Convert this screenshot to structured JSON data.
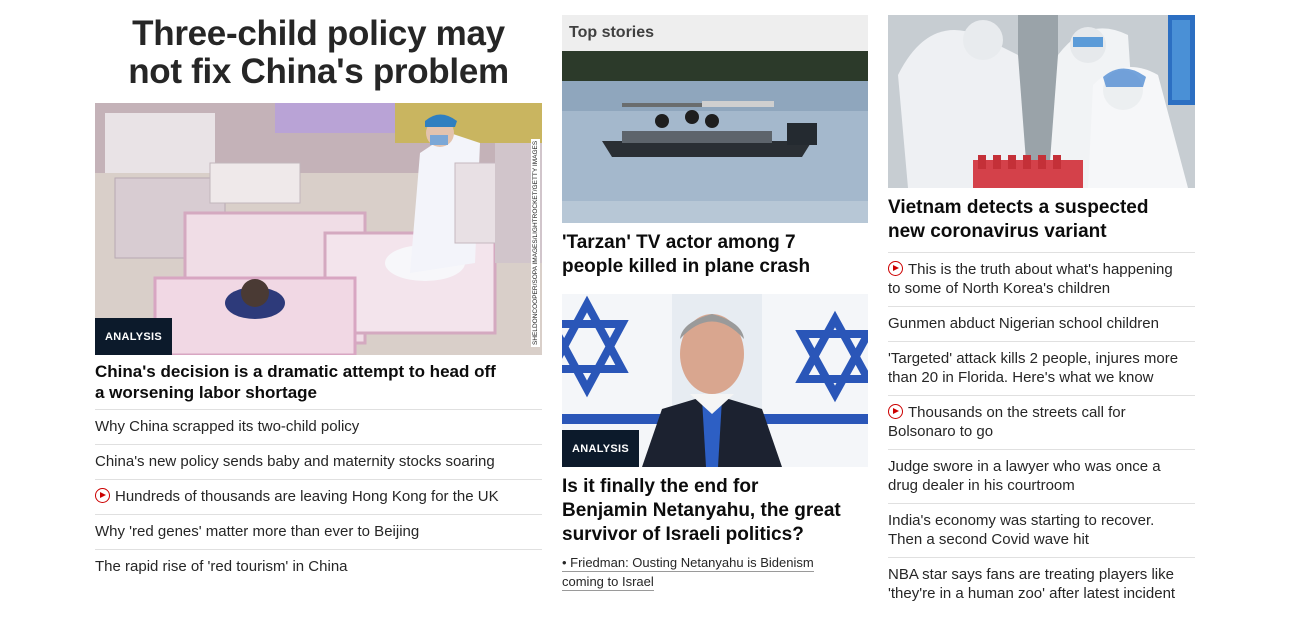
{
  "left": {
    "hero_title_line1": "Three-child policy may",
    "hero_title_line2": "not fix China's problem",
    "badge": "ANALYSIS",
    "credit": "SHELDONCOOPER/SOPA IMAGES/LIGHTROCKET/GETTY IMAGES",
    "headline_line1": "China's decision is a dramatic attempt to head off",
    "headline_line2": "a worsening labor shortage",
    "related": [
      {
        "text": "Why China scrapped its two-child policy",
        "video": false
      },
      {
        "text": "China's new policy sends baby and maternity stocks soaring",
        "video": false
      },
      {
        "text": "Hundreds of thousands are leaving Hong Kong for the UK",
        "video": true
      },
      {
        "text": "Why 'red genes' matter more than ever to Beijing",
        "video": false
      },
      {
        "text": "The rapid rise of 'red tourism' in China",
        "video": false
      }
    ]
  },
  "middle": {
    "section_label": "Top stories",
    "story1_line1": "'Tarzan' TV actor among 7",
    "story1_line2": "people killed in plane crash",
    "badge": "ANALYSIS",
    "story2_line1": "Is it finally the end for",
    "story2_line2": "Benjamin Netanyahu, the great",
    "story2_line3": "survivor of Israeli politics?",
    "sub_link_line1": "• Friedman: Ousting Netanyahu is Bidenism",
    "sub_link_line2": "coming to Israel"
  },
  "right": {
    "headline_line1": "Vietnam detects a suspected",
    "headline_line2": "new coronavirus variant",
    "list": [
      {
        "line1": "This is the truth about what's happening",
        "line2": "to some of North Korea's children",
        "video": true
      },
      {
        "line1": "Gunmen abduct Nigerian school children",
        "line2": "",
        "video": false
      },
      {
        "line1": "'Targeted' attack kills 2 people, injures more",
        "line2": "than 20 in Florida. Here's what we know",
        "video": false
      },
      {
        "line1": "Thousands on the streets call for",
        "line2": "Bolsonaro to go",
        "video": true
      },
      {
        "line1": "Judge swore in a lawyer who was once a",
        "line2": "drug dealer in his courtroom",
        "video": false
      },
      {
        "line1": "India's economy was starting to recover.",
        "line2": "Then a second Covid wave hit",
        "video": false
      },
      {
        "line1": "NBA star says fans are treating players like",
        "line2": "'they're in a human zoo' after latest incident",
        "video": false
      }
    ]
  },
  "colors": {
    "video_red": "#cc0000",
    "badge_bg": "#0c1a2b",
    "divider": "#e0e0e0",
    "section_bg": "#eeeeee"
  }
}
